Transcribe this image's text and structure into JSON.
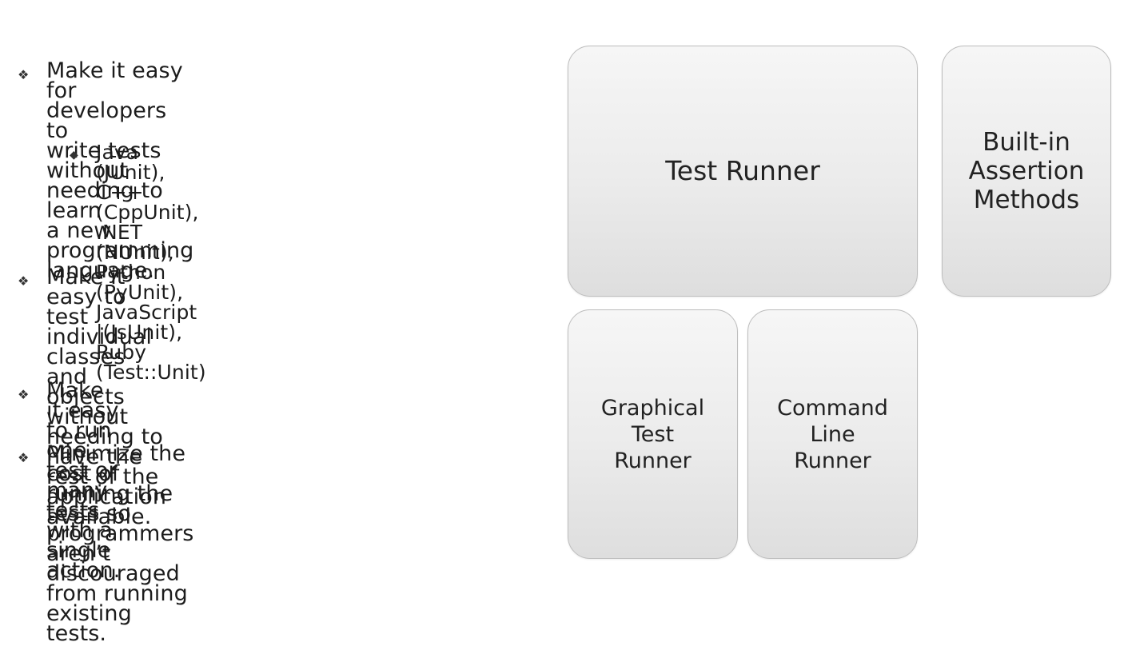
{
  "bullets": [
    {
      "level": 1,
      "marker": "❖",
      "lines": "Make it easy for developers to\nwrite tests without needing to learn\na new programming language."
    },
    {
      "level": 2,
      "marker": "◆",
      "lines": "Java (JUnit), C++ (CppUnit),\n.NET (NUnit), Python (PyUnit),\nJavaScript |(JsUnit), Ruby\n(Test::Unit)"
    },
    {
      "level": 1,
      "marker": "❖",
      "lines": "Make it easy to test individual\nclasses and objects without\nneeding to have the rest of the\napplication available."
    },
    {
      "level": 1,
      "marker": "❖",
      "lines": "Make it easy to run one test or\nmany tests with a single action."
    },
    {
      "level": 1,
      "marker": "❖",
      "lines": "Minimize the cost of running the\ntests so programmers aren’t\ndiscouraged from running existing\ntests."
    }
  ],
  "diagram": {
    "test_runner": "Test Runner",
    "assertions": "Built-in\nAssertion\nMethods",
    "graphical_runner": "Graphical\nTest\nRunner",
    "command_line_runner": "Command\nLine\nRunner"
  }
}
